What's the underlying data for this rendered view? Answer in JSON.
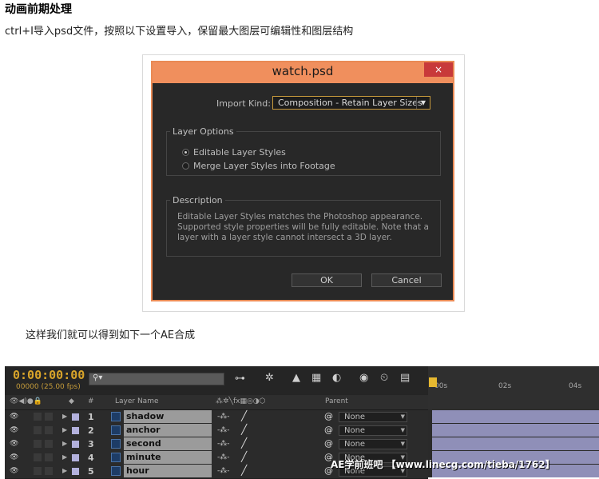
{
  "article": {
    "heading": "动画前期处理",
    "intro": "ctrl+I导入psd文件，按照以下设置导入，保留最大图层可编辑性和图层结构",
    "caption": "这样我们就可以得到如下一个AE合成"
  },
  "dialog": {
    "title": "watch.psd",
    "close_label": "×",
    "import_kind_label": "Import Kind:",
    "import_kind_value": "Composition - Retain Layer Sizes",
    "layer_options_title": "Layer Options",
    "options": [
      {
        "label": "Editable Layer Styles",
        "selected": true
      },
      {
        "label": "Merge Layer Styles into Footage",
        "selected": false
      }
    ],
    "description_title": "Description",
    "description_lines": [
      "Editable Layer Styles matches the Photoshop appearance.",
      "Supported style properties will be fully editable. Note that a",
      "layer with a layer style cannot intersect a 3D layer."
    ],
    "ok_label": "OK",
    "cancel_label": "Cancel",
    "colors": {
      "titlebar": "#f08f5d",
      "body": "#282828",
      "close": "#c8393a"
    }
  },
  "timeline": {
    "timecode": "0:00:00:00",
    "frame_info": "00000 (25.00 fps)",
    "search_icon": "search-icon",
    "columns": {
      "hash": "#",
      "layer_name": "Layer Name",
      "parent": "Parent"
    },
    "ruler_ticks": [
      "00s",
      "02s",
      "04s"
    ],
    "layers": [
      {
        "num": "1",
        "name": "shadow",
        "parent": "None"
      },
      {
        "num": "2",
        "name": "anchor",
        "parent": "None"
      },
      {
        "num": "3",
        "name": "second",
        "parent": "None"
      },
      {
        "num": "4",
        "name": "minute",
        "parent": "None"
      },
      {
        "num": "5",
        "name": "hour",
        "parent": "None"
      }
    ],
    "colors": {
      "timecode": "#d8a42a",
      "label": "#b3b1dd",
      "track": "#8f8fb8"
    }
  },
  "watermark": "AE学前班吧 【www.linecg.com/tieba/1762】"
}
